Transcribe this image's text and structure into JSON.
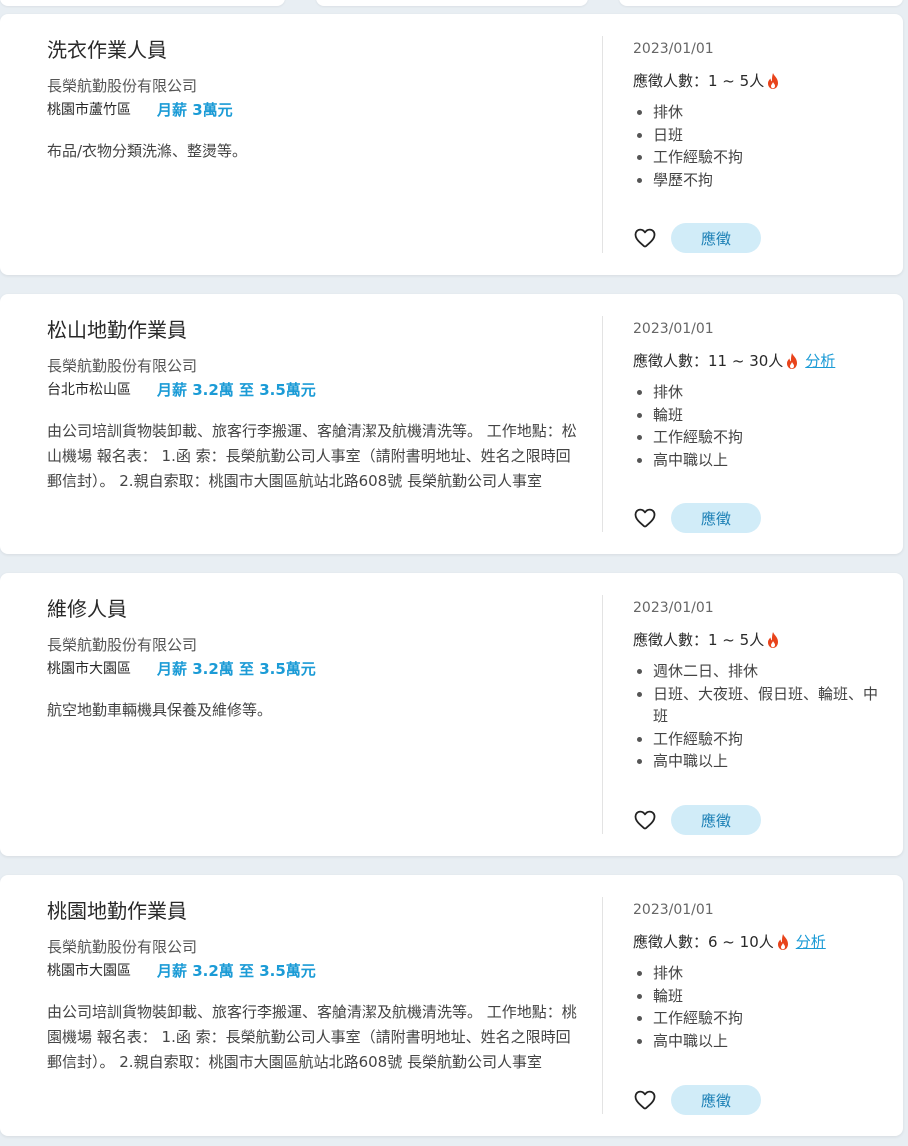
{
  "jobs": [
    {
      "title": "洗衣作業人員",
      "company": "長榮航勤股份有限公司",
      "location": "桃園市蘆竹區",
      "salary": "月薪 3萬元",
      "description": "布品/衣物分類洗滌、整燙等。",
      "date": "2023/01/01",
      "applicants": "應徵人數：1 ~ 5人",
      "analysis": "",
      "tags": [
        "排休",
        "日班",
        "工作經驗不拘",
        "學歷不拘"
      ],
      "apply_label": "應徵"
    },
    {
      "title": "松山地勤作業員",
      "company": "長榮航勤股份有限公司",
      "location": "台北市松山區",
      "salary": "月薪 3.2萬 至 3.5萬元",
      "description": "由公司培訓貨物裝卸載、旅客行李搬運、客艙清潔及航機清洗等。 工作地點：松山機場 報名表： 1.函 索：長榮航勤公司人事室（請附書明地址、姓名之限時回郵信封）。 2.親自索取：桃園市大園區航站北路608號 長榮航勤公司人事室",
      "date": "2023/01/01",
      "applicants": "應徵人數：11 ~ 30人",
      "analysis": "分析",
      "tags": [
        "排休",
        "輪班",
        "工作經驗不拘",
        "高中職以上"
      ],
      "apply_label": "應徵"
    },
    {
      "title": "維修人員",
      "company": "長榮航勤股份有限公司",
      "location": "桃園市大園區",
      "salary": "月薪 3.2萬 至 3.5萬元",
      "description": "航空地勤車輛機具保養及維修等。",
      "date": "2023/01/01",
      "applicants": "應徵人數：1 ~ 5人",
      "analysis": "",
      "tags": [
        "週休二日、排休",
        "日班、大夜班、假日班、輪班、中班",
        "工作經驗不拘",
        "高中職以上"
      ],
      "apply_label": "應徵"
    },
    {
      "title": "桃園地勤作業員",
      "company": "長榮航勤股份有限公司",
      "location": "桃園市大園區",
      "salary": "月薪 3.2萬 至 3.5萬元",
      "description": "由公司培訓貨物裝卸載、旅客行李搬運、客艙清潔及航機清洗等。 工作地點：桃園機場 報名表： 1.函 索：長榮航勤公司人事室（請附書明地址、姓名之限時回郵信封）。 2.親自索取：桃園市大園區航站北路608號 長榮航勤公司人事室",
      "date": "2023/01/01",
      "applicants": "應徵人數：6 ~ 10人",
      "analysis": "分析",
      "tags": [
        "排休",
        "輪班",
        "工作經驗不拘",
        "高中職以上"
      ],
      "apply_label": "應徵"
    }
  ],
  "colors": {
    "accent": "#1b9bd6",
    "apply_bg": "#d1ecf8",
    "fire": "#e8431b"
  },
  "icons": {
    "favorite": "heart-outline-icon",
    "hot": "fire-icon"
  }
}
